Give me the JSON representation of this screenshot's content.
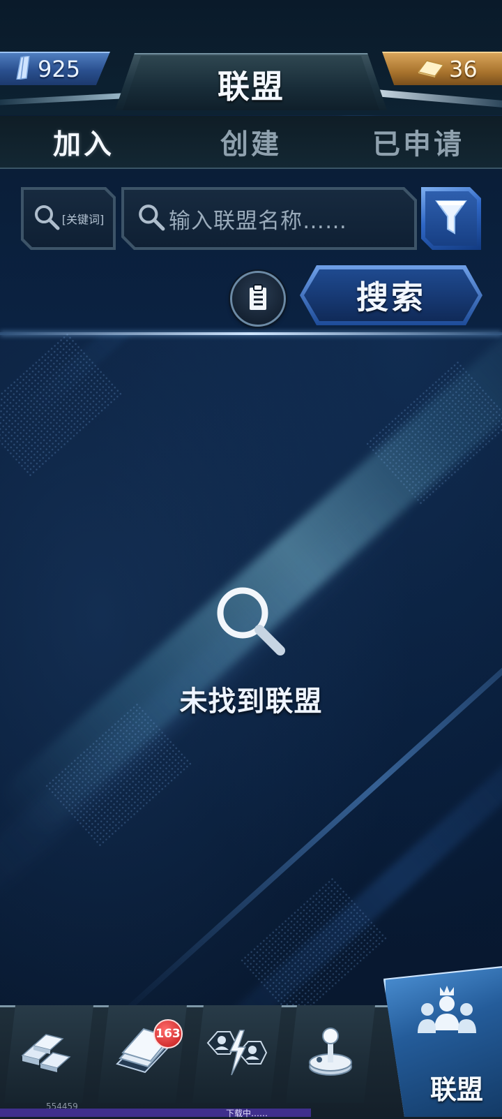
{
  "header": {
    "title": "联盟",
    "currency_left": {
      "value": "925",
      "icon": "crystal-icon"
    },
    "currency_right": {
      "value": "36",
      "icon": "gold-bar-icon"
    }
  },
  "tabs": [
    {
      "label": "加入",
      "active": true
    },
    {
      "label": "创建",
      "active": false
    },
    {
      "label": "已申请",
      "active": false
    }
  ],
  "search": {
    "keyword_label": "[关键词]",
    "name_placeholder": "输入联盟名称……",
    "filter_icon": "filter-icon",
    "clipboard_icon": "clipboard-icon",
    "search_button": "搜索"
  },
  "empty_state": {
    "icon": "magnifier-icon",
    "message": "未找到联盟"
  },
  "bottom_nav": {
    "items": [
      {
        "icon": "resources-icon"
      },
      {
        "icon": "cards-icon",
        "badge": "163"
      },
      {
        "icon": "battle-icon"
      },
      {
        "icon": "joystick-icon"
      },
      {
        "icon": "alliance-icon",
        "label": "联盟",
        "active": true
      }
    ]
  },
  "footer": {
    "id": "554459",
    "download_status": "下载中……",
    "download_progress": 0.62
  },
  "colors": {
    "accent_blue": "#2f67c6",
    "gold": "#d8a45a",
    "badge_red": "#c01818",
    "background": "#07162b"
  }
}
